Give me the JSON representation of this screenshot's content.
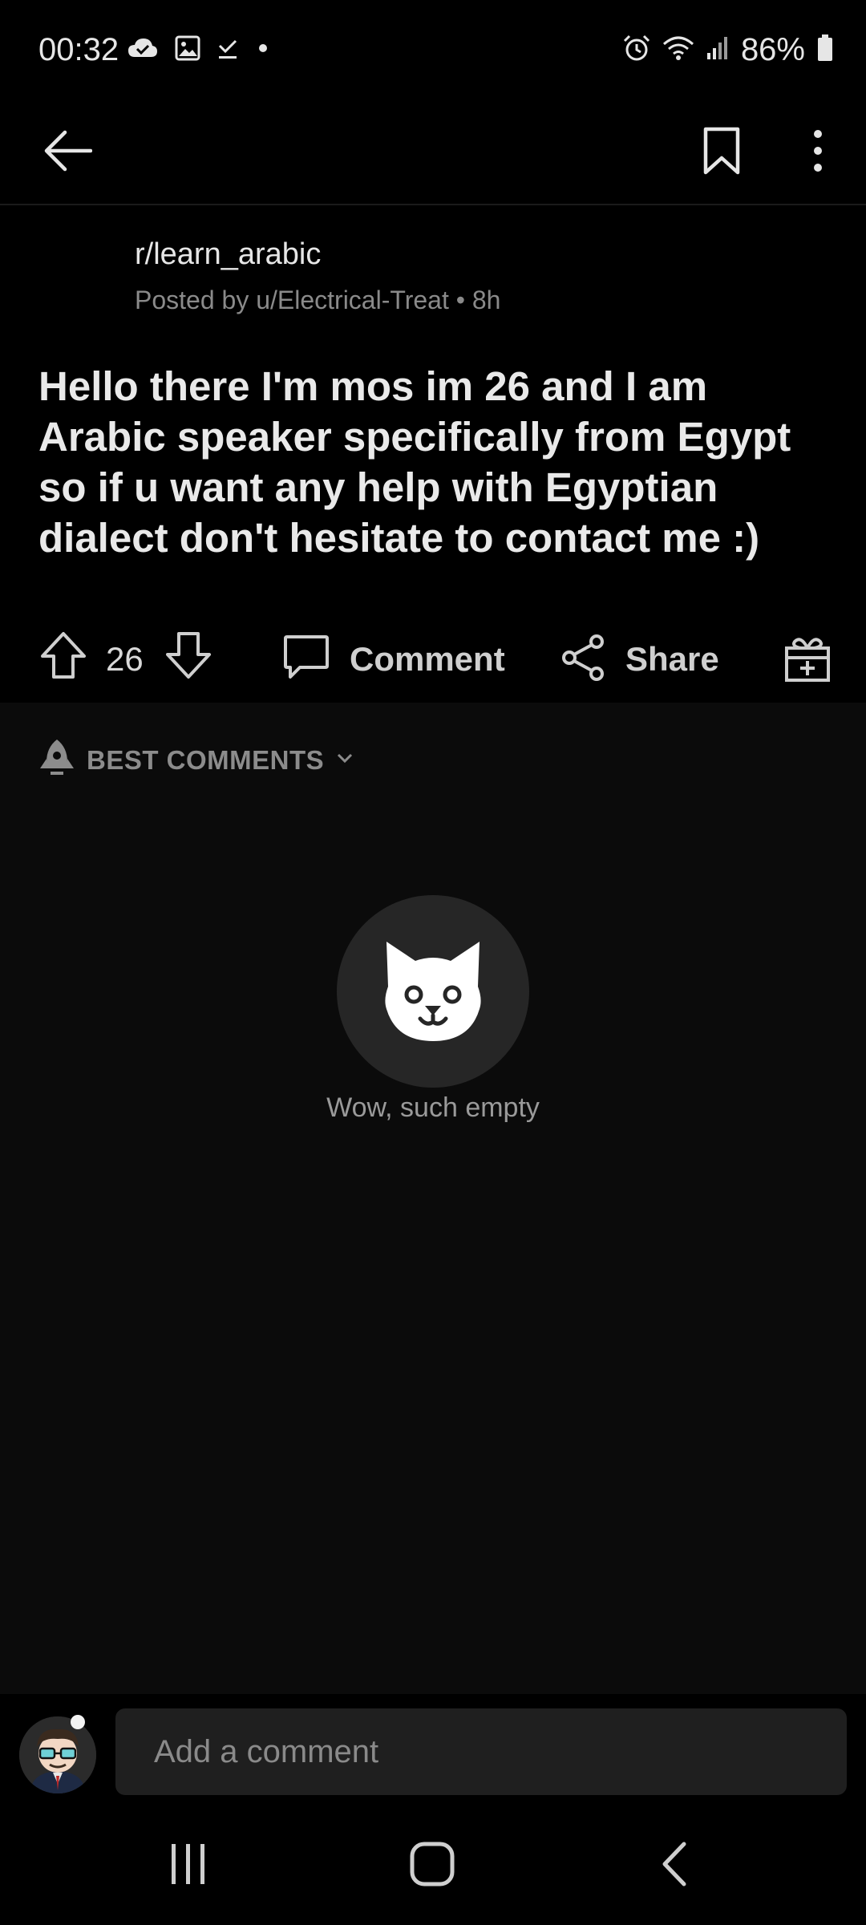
{
  "status_bar": {
    "time": "00:32",
    "battery": "86%",
    "left_icons": [
      "cloud-check-icon",
      "image-icon",
      "download-done-icon",
      "dot-icon"
    ],
    "right_icons": [
      "alarm-icon",
      "wifi-icon",
      "signal-icon",
      "battery-icon"
    ]
  },
  "app_bar": {
    "icons": [
      "back-arrow-icon",
      "bookmark-icon",
      "more-vertical-icon"
    ]
  },
  "post": {
    "subreddit": "r/learn_arabic",
    "posted_by": "Posted by u/Electrical-Treat • 8h",
    "title": "Hello there I'm mos im 26 and I am Arabic speaker specifically from Egypt so if u want any help with Egyptian dialect don't hesitate to contact me :)",
    "votes": "26",
    "comment_label": "Comment",
    "share_label": "Share"
  },
  "comments": {
    "sort_label": "BEST COMMENTS",
    "empty_text": "Wow, such empty"
  },
  "comment_bar": {
    "placeholder": "Add a comment"
  },
  "colors": {
    "background": "#000000",
    "comments_background": "#0b0b0b",
    "input_background": "#1f1f1f",
    "text_primary": "#e9e9e9",
    "text_secondary": "#8a8a8a"
  }
}
